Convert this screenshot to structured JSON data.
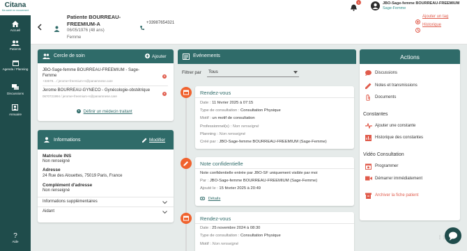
{
  "sidebar": {
    "logo": "Citana",
    "logo_sub": "Ma santé en mouvement",
    "items": [
      {
        "label": "Accueil"
      },
      {
        "label": "Patients"
      },
      {
        "label": "Agenda / Planning"
      },
      {
        "label": "Discussions"
      },
      {
        "label": "Annuaire"
      }
    ],
    "help": "Aide"
  },
  "header": {
    "patient_name": "Patiente BOURREAU-FREEMIUM-A",
    "dob": "06/05/1976 (48 ans)",
    "sex": "Femme",
    "phone": "+33987654321",
    "phone2": "--",
    "notif_count": "1",
    "user_name": "JBO-Sage-femme BOURREAU-FREEMIUM",
    "user_role": "Sage-Femme",
    "add_tag": "Ajouter un tag",
    "history": "Historique"
  },
  "cercle": {
    "title": "Cercle de soin",
    "add": "Ajouter",
    "members": [
      {
        "name": "JBO-Sage-femme BOURREAU-FREEMIUM - Sage-Femme",
        "contact": "+33678... / jerome+freemium+s@panamnese.care"
      },
      {
        "name": "Jerome BOURREAU-GYNECO - Gynécologie-obstétrique",
        "contact": "0670721994 / jerome+freemium+s@panamnese.care"
      }
    ],
    "define": "Définir un médecin traitant"
  },
  "infos": {
    "title": "Informations",
    "modify": "Modifier",
    "matricule_label": "Matricule INS",
    "matricule_value": "Non renseigné",
    "address_label": "Adresse",
    "address_value": "24 Rue des Alouettes, 75019 Paris, France",
    "complement_label": "Complément d'adresse",
    "complement_value": "Non renseigné",
    "extra": "Informations supplémentaires",
    "aidant": "Aidant"
  },
  "events": {
    "title": "Evénements",
    "filter_label": "Filtrer par",
    "filter_value": "Tous",
    "e1": {
      "title": "Rendez-vous",
      "date_k": "Date :",
      "date_v": "11 février 2025 à 07:15",
      "type_k": "Type de consultation :",
      "type_v": "Consultation Physique",
      "motif_k": "Motif :",
      "motif_v": "un motif de consultation",
      "pro_k": "Professionnel(s) :",
      "pro_v": "Non renseigné",
      "plan_k": "Planning :",
      "plan_v": "Non renseigné",
      "cree_k": "Créé par :",
      "cree_v": "JBO-Sage-femme BOURREAU-FREEMIUM (Sage-Femme)"
    },
    "e2": {
      "title": "Note confidentielle",
      "text": "Note confidentielle entrée par JBO-SF uniquement visible par moi",
      "par_k": "Par :",
      "par_v": "JBO-Sage-femme BOURREAU-FREEMIUM (Sage-Femme)",
      "aj_k": "Ajouté le :",
      "aj_v": "15 février 2025 à 20:49",
      "details": "Détails"
    },
    "e3": {
      "title": "Rendez-vous",
      "date_k": "Date :",
      "date_v": "25 novembre 2024 à 08:30",
      "type_k": "Type de consultation :",
      "type_v": "Consultation Physique",
      "motif_k": "Motif :",
      "motif_v": "Non renseigné"
    }
  },
  "actions": {
    "title": "Actions",
    "discussions": "Discussions",
    "notes": "Notes et transmissions",
    "documents": "Documents",
    "constantes": "Constantes",
    "add_const": "Ajouter une constante",
    "hist_const": "Historique des constantes",
    "video": "Vidéo Consultation",
    "programmer": "Programmer",
    "demarrer": "Démarrer immédiatement",
    "archive": "Archiver la fiche patient"
  }
}
